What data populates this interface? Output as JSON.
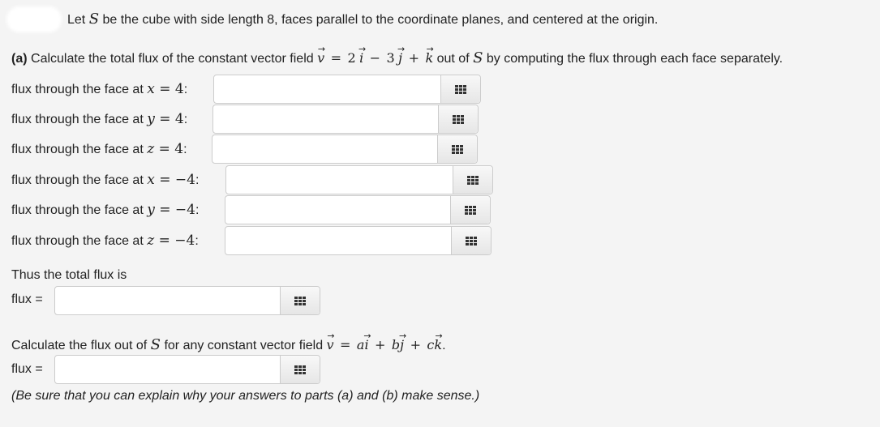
{
  "intro": {
    "prefix": "Let ",
    "S": "S",
    "suffix": " be the cube with side length 8, faces parallel to the coordinate planes, and centered at the origin."
  },
  "part_a": {
    "label": "(a)",
    "text_before": " Calculate the total flux of the constant vector field ",
    "field": {
      "v": "v",
      "eq": "=",
      "c1": "2",
      "i": "i",
      "op1": "−",
      "c2": "3",
      "j": "j",
      "op2": "+",
      "k": "k"
    },
    "text_middle": " out of ",
    "S": "S",
    "text_after": " by computing the flux through each face separately."
  },
  "faces": [
    {
      "label": "flux through the face at ",
      "var": "x",
      "eq": " = ",
      "val": "4",
      "colon": ":",
      "value": ""
    },
    {
      "label": "flux through the face at ",
      "var": "y",
      "eq": " = ",
      "val": "4",
      "colon": ":",
      "value": ""
    },
    {
      "label": "flux through the face at ",
      "var": "z",
      "eq": " = ",
      "val": "4",
      "colon": ":",
      "value": ""
    },
    {
      "label": "flux through the face at ",
      "var": "x",
      "eq": " = ",
      "val": "−4",
      "colon": ":",
      "value": ""
    },
    {
      "label": "flux through the face at ",
      "var": "y",
      "eq": " = ",
      "val": "−4",
      "colon": ":",
      "value": ""
    },
    {
      "label": "flux through the face at ",
      "var": "z",
      "eq": " = ",
      "val": "−4",
      "colon": ":",
      "value": ""
    }
  ],
  "total": {
    "text": "Thus the total flux is",
    "label": "flux =",
    "value": ""
  },
  "part_b": {
    "text_before": "Calculate the flux out of ",
    "S": "S",
    "text_middle": " for any constant vector field ",
    "field": {
      "v": "v",
      "eq": "=",
      "a": "a",
      "i": "i",
      "op1": "+",
      "b": "b",
      "j": "j",
      "op2": "+",
      "c": "c",
      "k": "k",
      "end": "."
    },
    "label": "flux =",
    "value": ""
  },
  "note": "(Be sure that you can explain why your answers to parts (a) and (b) make sense.)",
  "icons": {
    "keypad": "keypad-grid-icon"
  }
}
